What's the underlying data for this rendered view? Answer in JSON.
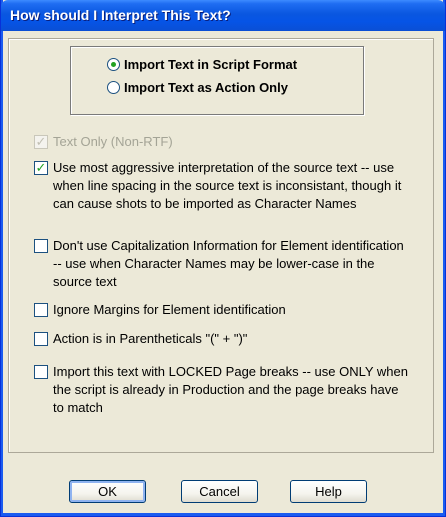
{
  "window": {
    "title": "How should I Interpret This Text?"
  },
  "format_options": [
    {
      "label": "Import Text in Script Format",
      "selected": true
    },
    {
      "label": "Import Text as Action Only",
      "selected": false
    }
  ],
  "options": [
    {
      "label": "Text Only (Non-RTF)",
      "checked": true,
      "disabled": true
    },
    {
      "label": "Use most aggressive interpretation of the source text -- use when line spacing in the source text is inconsistant, though it can cause shots to be imported as Character Names",
      "checked": true,
      "disabled": false
    },
    {
      "label": "Don't use Capitalization Information for Element identification -- use when Character Names may be lower-case in the source text",
      "checked": false,
      "disabled": false
    },
    {
      "label": "Ignore Margins for Element identification",
      "checked": false,
      "disabled": false
    },
    {
      "label": "Action is in Parentheticals \"(\" + \")\"",
      "checked": false,
      "disabled": false
    },
    {
      "label": "Import this text with LOCKED Page breaks -- use ONLY when the script is already in Production and the page breaks have to match",
      "checked": false,
      "disabled": false
    }
  ],
  "buttons": {
    "ok": "OK",
    "cancel": "Cancel",
    "help": "Help"
  }
}
